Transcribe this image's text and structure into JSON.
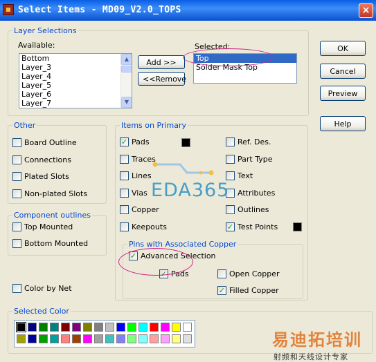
{
  "window": {
    "title": "Select Items - MD09_V2.0_TOPS",
    "close_glyph": "×"
  },
  "layer_selections": {
    "legend": "Layer Selections",
    "available_label": "Available:",
    "available_items": [
      "Bottom",
      "Layer_3",
      "Layer_4",
      "Layer_5",
      "Layer_6",
      "Layer_7"
    ],
    "selected_label": "Selected:",
    "selected_items": [
      "Top",
      "Solder Mask Top"
    ],
    "selected_index": 0,
    "add_label": "Add >>",
    "remove_label": "<<Remove"
  },
  "buttons": {
    "ok": "OK",
    "cancel": "Cancel",
    "preview": "Preview",
    "help": "Help"
  },
  "other": {
    "legend": "Other",
    "items": [
      {
        "label": "Board Outline",
        "checked": false
      },
      {
        "label": "Connections",
        "checked": false
      },
      {
        "label": "Plated Slots",
        "checked": false
      },
      {
        "label": "Non-plated Slots",
        "checked": false
      }
    ]
  },
  "component_outlines": {
    "legend": "Component outlines",
    "items": [
      {
        "label": "Top Mounted",
        "checked": false
      },
      {
        "label": "Bottom Mounted",
        "checked": false
      }
    ]
  },
  "color_by_net": {
    "label": "Color by Net",
    "checked": false
  },
  "items_on_primary": {
    "legend": "Items on Primary",
    "left": [
      {
        "label": "Pads",
        "checked": true
      },
      {
        "label": "Traces",
        "checked": false
      },
      {
        "label": "Lines",
        "checked": false
      },
      {
        "label": "Vias",
        "checked": false
      },
      {
        "label": "Copper",
        "checked": false
      },
      {
        "label": "Keepouts",
        "checked": false
      }
    ],
    "right": [
      {
        "label": "Ref. Des.",
        "checked": false
      },
      {
        "label": "Part Type",
        "checked": false
      },
      {
        "label": "Text",
        "checked": false
      },
      {
        "label": "Attributes",
        "checked": false
      },
      {
        "label": "Outlines",
        "checked": false
      },
      {
        "label": "Test Points",
        "checked": true
      }
    ],
    "pads_color": "#000000",
    "testpoints_color": "#000000"
  },
  "pins_copper": {
    "legend": "Pins with Associated Copper",
    "advanced": {
      "label": "Advanced Selection",
      "checked": true
    },
    "pads": {
      "label": "Pads",
      "checked": true
    },
    "open_copper": {
      "label": "Open Copper",
      "checked": false
    },
    "filled_copper": {
      "label": "Filled Copper",
      "checked": true
    }
  },
  "selected_color": {
    "legend": "Selected Color",
    "row1": [
      "#000000",
      "#000080",
      "#008000",
      "#008080",
      "#800000",
      "#800080",
      "#808000",
      "#808080",
      "#c0c0c0",
      "#0000ff",
      "#00ff00",
      "#00ffff",
      "#ff0000",
      "#ff00ff",
      "#ffff00",
      "#ffffff"
    ],
    "row2": [
      "#a0a000",
      "#0000a0",
      "#00a000",
      "#00a0a0",
      "#ff8080",
      "#a04000",
      "#ff00ff",
      "#a0a0a0",
      "#40c0c0",
      "#8080ff",
      "#80ff80",
      "#80ffff",
      "#ffa0a0",
      "#ffa0ff",
      "#ffff80",
      "#e0e0e0"
    ]
  },
  "watermark": {
    "eda": "EDA365",
    "cn_main": "易迪拓培训",
    "cn_sub": "射频和天线设计专家"
  }
}
